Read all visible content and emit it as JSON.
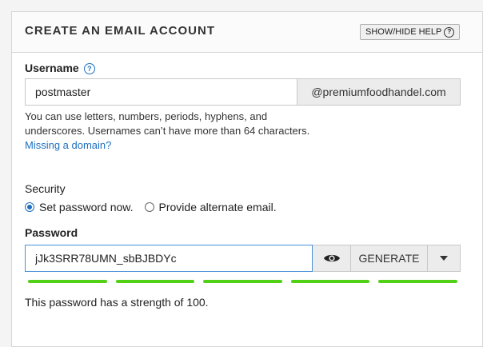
{
  "panel": {
    "title": "CREATE AN EMAIL ACCOUNT",
    "help_button": "SHOW/HIDE HELP",
    "help_icon": "question-circle-icon"
  },
  "username": {
    "label": "Username",
    "help_icon": "question-circle-icon",
    "value": "postmaster",
    "domain_suffix": "@premiumfoodhandel.com",
    "help_text": "You can use letters, numbers, periods, hyphens, and underscores. Usernames can’t have more than 64 characters.",
    "missing_domain_link": "Missing a domain?"
  },
  "security": {
    "label": "Security",
    "options": [
      {
        "label": "Set password now.",
        "checked": true
      },
      {
        "label": "Provide alternate email.",
        "checked": false
      }
    ]
  },
  "password": {
    "label": "Password",
    "value": "jJk3SRR78UMN_sbBJBDYc",
    "show_icon": "eye-icon",
    "generate_label": "GENERATE",
    "dropdown_icon": "caret-down-icon",
    "strength_value": 100,
    "strength_segments": 5,
    "strength_color": "#52d016",
    "strength_text": "This password has a strength of 100."
  },
  "colors": {
    "accent": "#1e6fbf",
    "meter_fill": "#52d016"
  }
}
